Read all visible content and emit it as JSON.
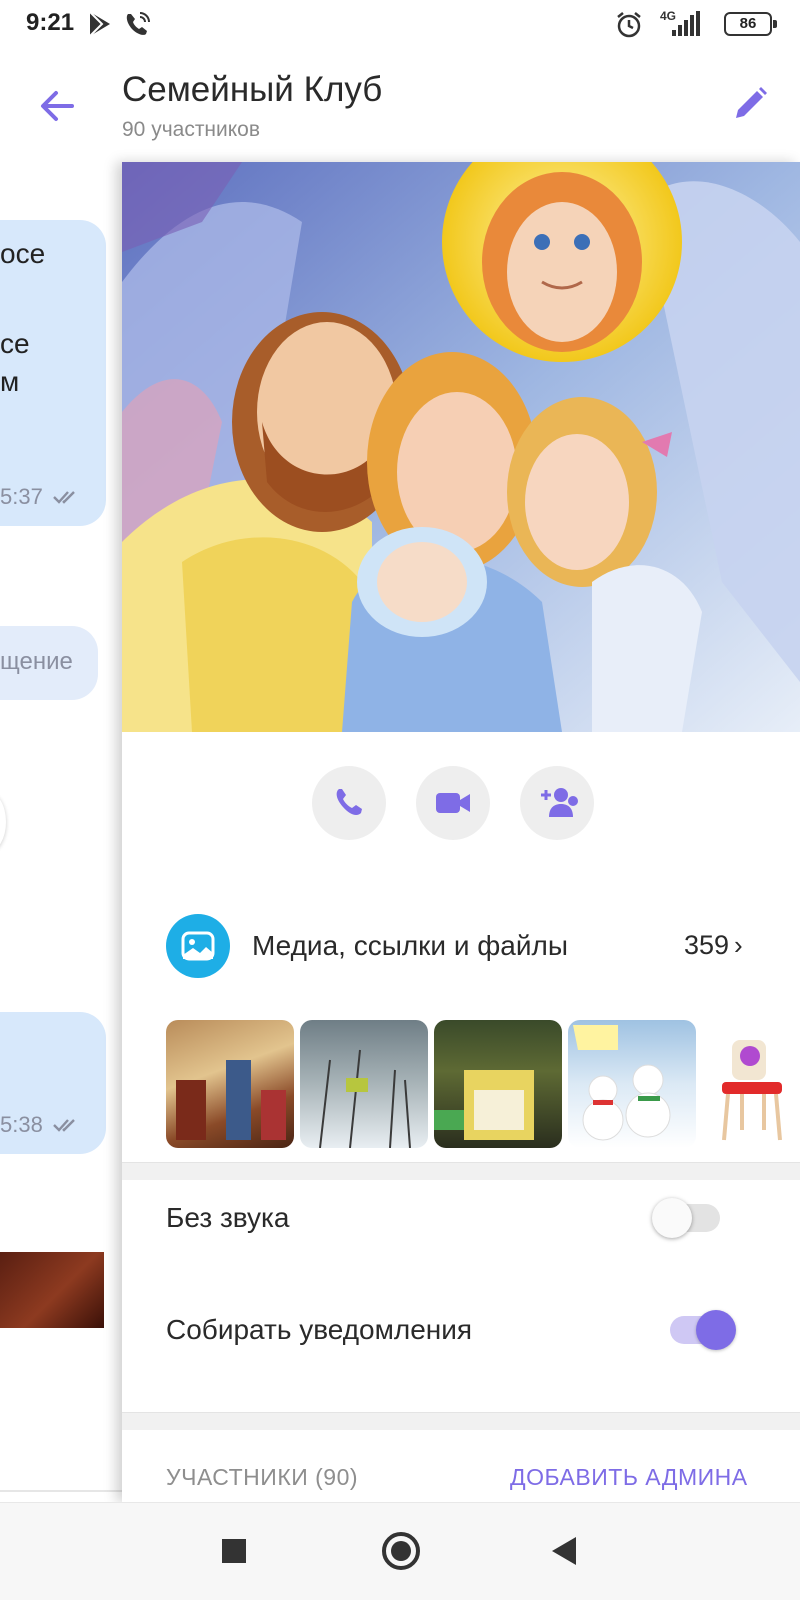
{
  "status_bar": {
    "time": "9:21",
    "battery": "86",
    "network": "4G",
    "icons": [
      "play-store-icon",
      "phone-call-icon",
      "alarm-icon",
      "signal-icon",
      "battery-icon"
    ]
  },
  "header": {
    "title": "Семейный Клуб",
    "subtitle": "90 участников",
    "back_icon": "back-arrow-icon",
    "edit_icon": "pencil-icon"
  },
  "chat_background": {
    "bubbles": [
      {
        "lines": [
          "осе",
          "се",
          "м"
        ],
        "time": "5:37"
      },
      {
        "lines": [
          "щение"
        ]
      },
      {
        "lines": [],
        "time": "5:38"
      }
    ]
  },
  "actions": [
    "call-icon",
    "video-call-icon",
    "add-participants-icon"
  ],
  "media": {
    "label": "Медиа, ссылки и файлы",
    "count": "359",
    "arrow": "›"
  },
  "settings": {
    "mute_label": "Без звука",
    "mute_on": false,
    "collect_label": "Собирать уведомления",
    "collect_on": true
  },
  "members": {
    "label": "УЧАСТНИКИ (90)",
    "add_admin": "ДОБАВИТЬ АДМИНА"
  },
  "colors": {
    "accent": "#7e6ce6",
    "media_icon": "#1eaee6",
    "bubble": "#d7e8fb"
  }
}
